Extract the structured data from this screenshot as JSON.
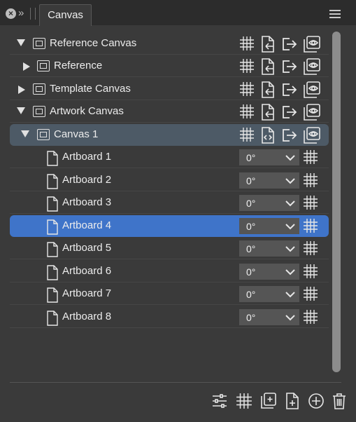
{
  "panel": {
    "tab_label": "Canvas",
    "close_symbol": "×",
    "collapse_symbol": "»"
  },
  "tree": {
    "reference_canvas": {
      "label": "Reference Canvas",
      "expanded": true
    },
    "reference": {
      "label": "Reference",
      "expanded": false
    },
    "template_canvas": {
      "label": "Template Canvas",
      "expanded": false
    },
    "artwork_canvas": {
      "label": "Artwork Canvas",
      "expanded": true
    },
    "canvas_1": {
      "label": "Canvas 1",
      "expanded": true,
      "selected": true
    }
  },
  "artboards": [
    {
      "label": "Artboard 1",
      "rotation": "0°"
    },
    {
      "label": "Artboard 2",
      "rotation": "0°"
    },
    {
      "label": "Artboard 3",
      "rotation": "0°"
    },
    {
      "label": "Artboard 4",
      "rotation": "0°",
      "selected": true
    },
    {
      "label": "Artboard 5",
      "rotation": "0°"
    },
    {
      "label": "Artboard 6",
      "rotation": "0°"
    },
    {
      "label": "Artboard 7",
      "rotation": "0°"
    },
    {
      "label": "Artboard 8",
      "rotation": "0°"
    }
  ],
  "row_icons": [
    "grid-icon",
    "document-link-icon",
    "export-icon",
    "visibility-icon"
  ],
  "footer_icons": [
    "settings-sliders-icon",
    "grid-icon",
    "duplicate-icon",
    "new-document-icon",
    "add-icon",
    "trash-icon"
  ],
  "colors": {
    "panel_bg": "#3a3a3a",
    "selected_canvas": "#4d5a66",
    "selected_artboard": "#3f74c9"
  }
}
